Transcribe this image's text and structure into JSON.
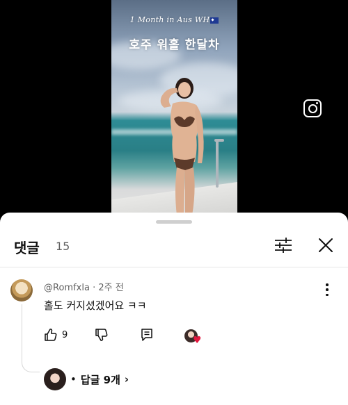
{
  "video": {
    "caption_line1": "1 Month in Aus WH",
    "caption_line2": "호주 워홀 한달차"
  },
  "comments_sheet": {
    "title": "댓글",
    "count": "15"
  },
  "comment": {
    "author": "@Romfxla",
    "time": "2주 전",
    "text": "홀도 커지셨겠어요 ㅋㅋ",
    "likes": "9"
  },
  "replies": {
    "label": "답글 9개",
    "bullet": "•",
    "chevron": "›"
  },
  "icons": {
    "top_right": "instagram-icon",
    "filter": "sliders-icon",
    "close": "close-icon",
    "more": "more-vertical-icon",
    "like": "thumbs-up-icon",
    "dislike": "thumbs-down-icon",
    "reply": "comment-reply-icon",
    "creator_heart": "heart-icon"
  },
  "colors": {
    "heart": "#e3173e",
    "text_primary": "#0f0f0f",
    "text_secondary": "#606060"
  }
}
